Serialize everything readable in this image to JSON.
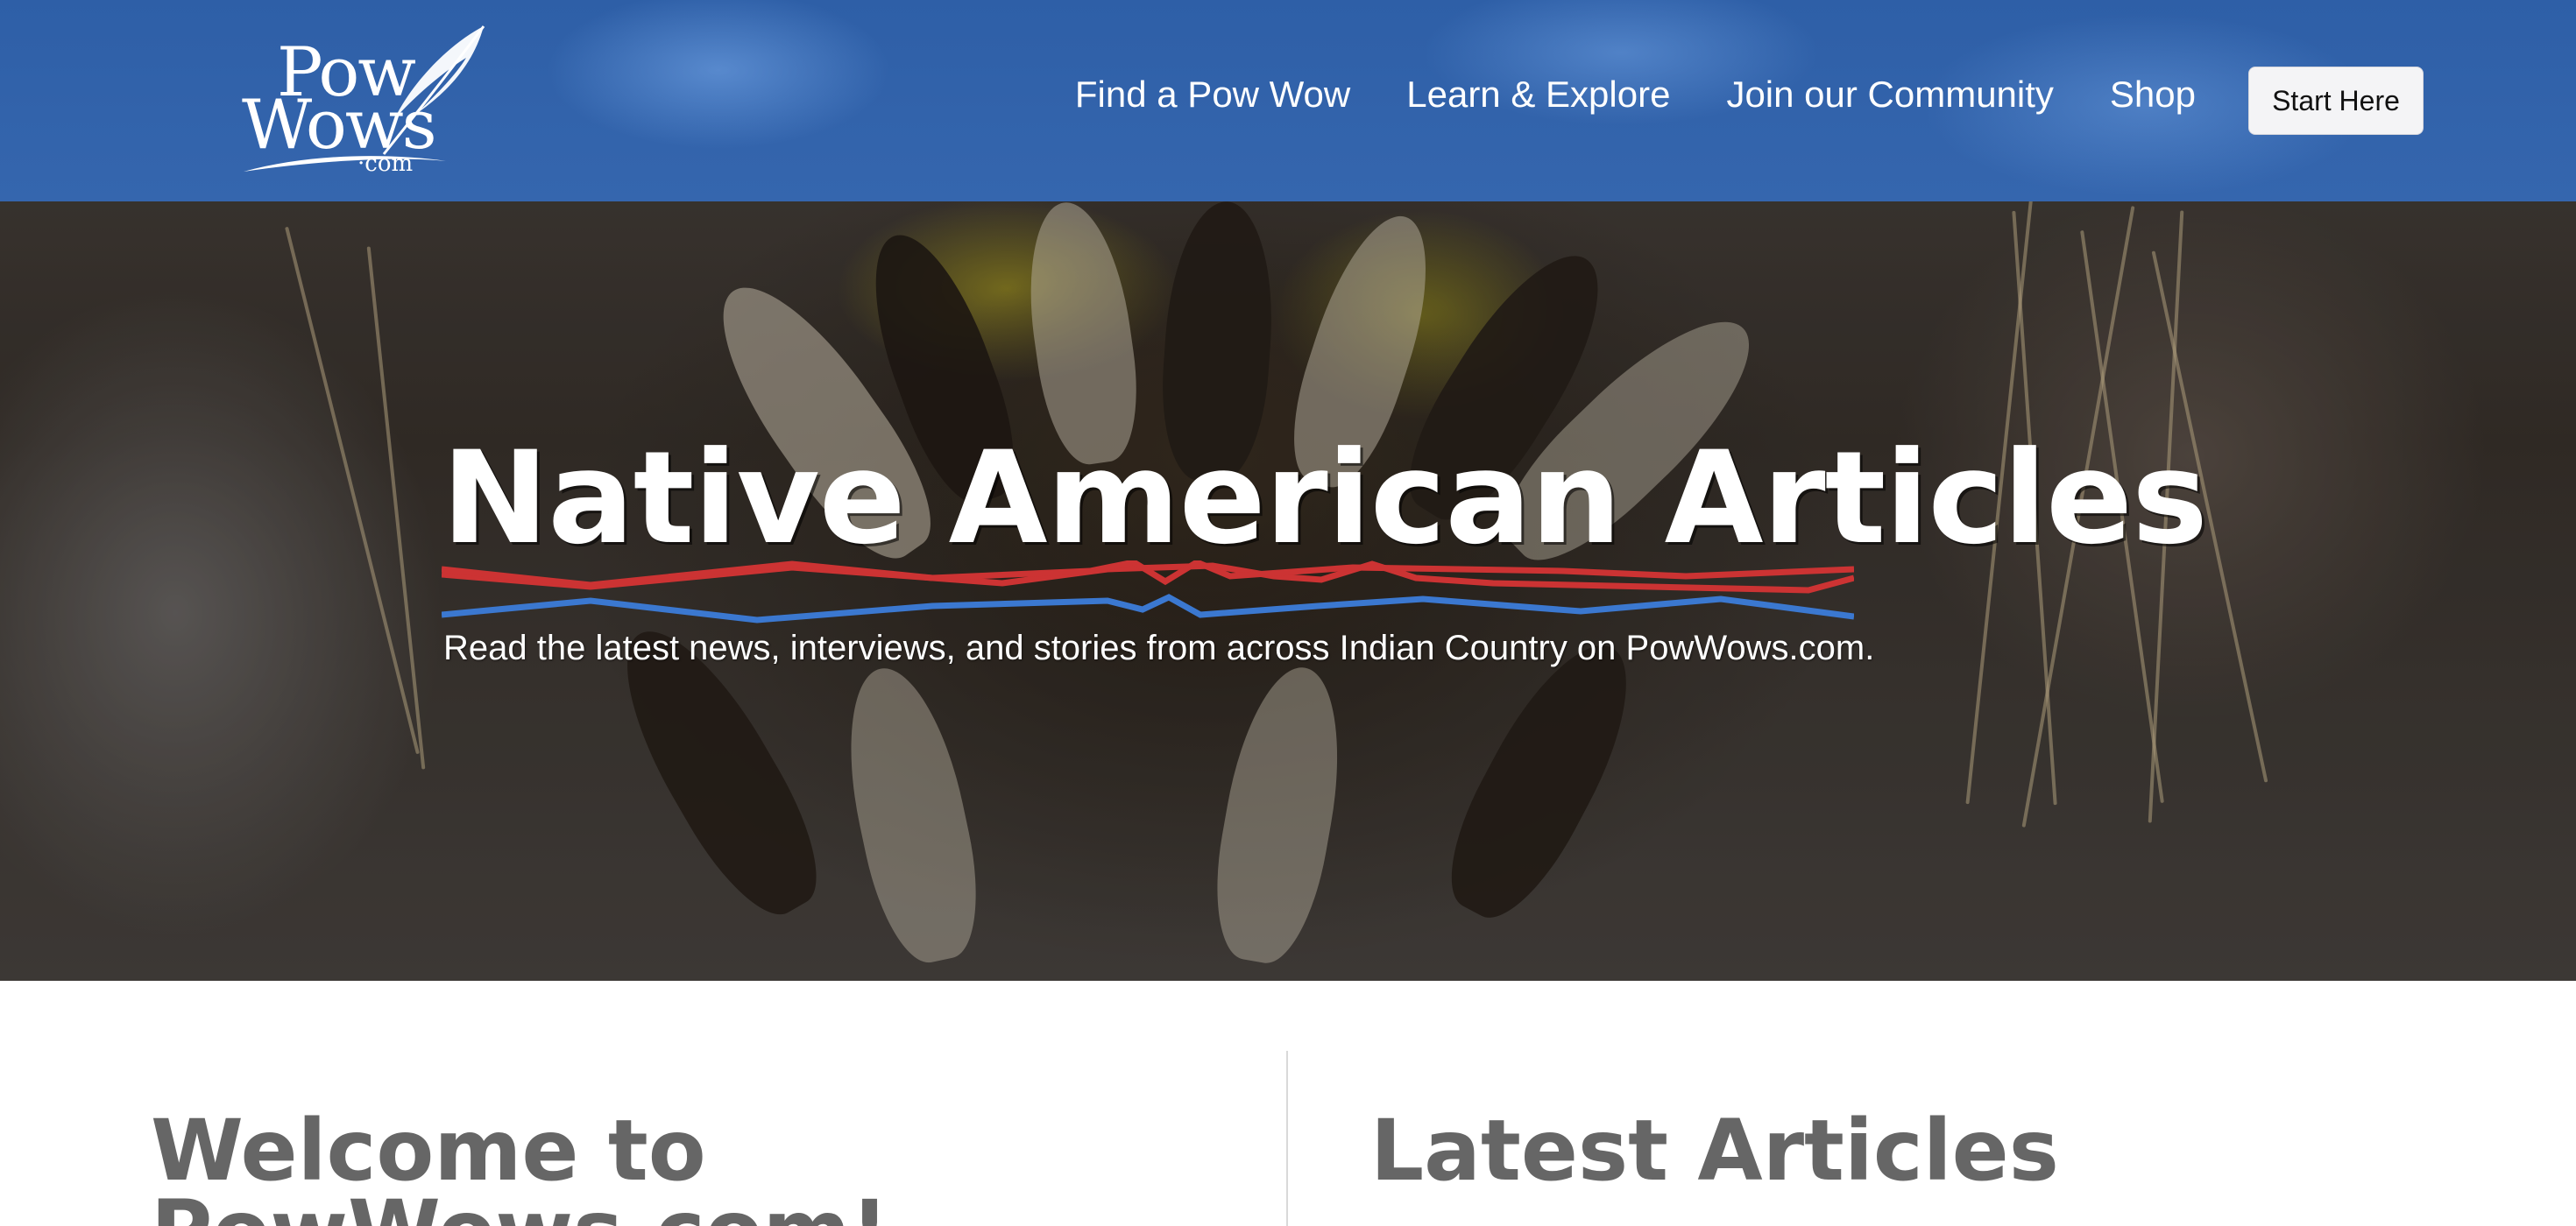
{
  "header": {
    "logo": {
      "line1": "Pow",
      "line2": "Wows",
      "line3": "·com"
    },
    "nav": [
      {
        "label": "Find a Pow Wow"
      },
      {
        "label": "Learn & Explore"
      },
      {
        "label": "Join our Community"
      },
      {
        "label": "Shop"
      }
    ],
    "cta_label": "Start Here"
  },
  "hero": {
    "title": "Native American Articles",
    "subtitle": "Read the latest news, interviews, and stories from across Indian Country on PowWows.com."
  },
  "sections": {
    "welcome_heading_line1": "Welcome to",
    "welcome_heading_line2": "PowWows.com!",
    "latest_heading": "Latest Articles"
  },
  "colors": {
    "header_blue": "#3566ae",
    "zigzag_red": "#cc3333",
    "zigzag_blue": "#3b78d0",
    "heading_gray": "#666666"
  },
  "icons": {
    "logo_feather": "feather-icon"
  }
}
